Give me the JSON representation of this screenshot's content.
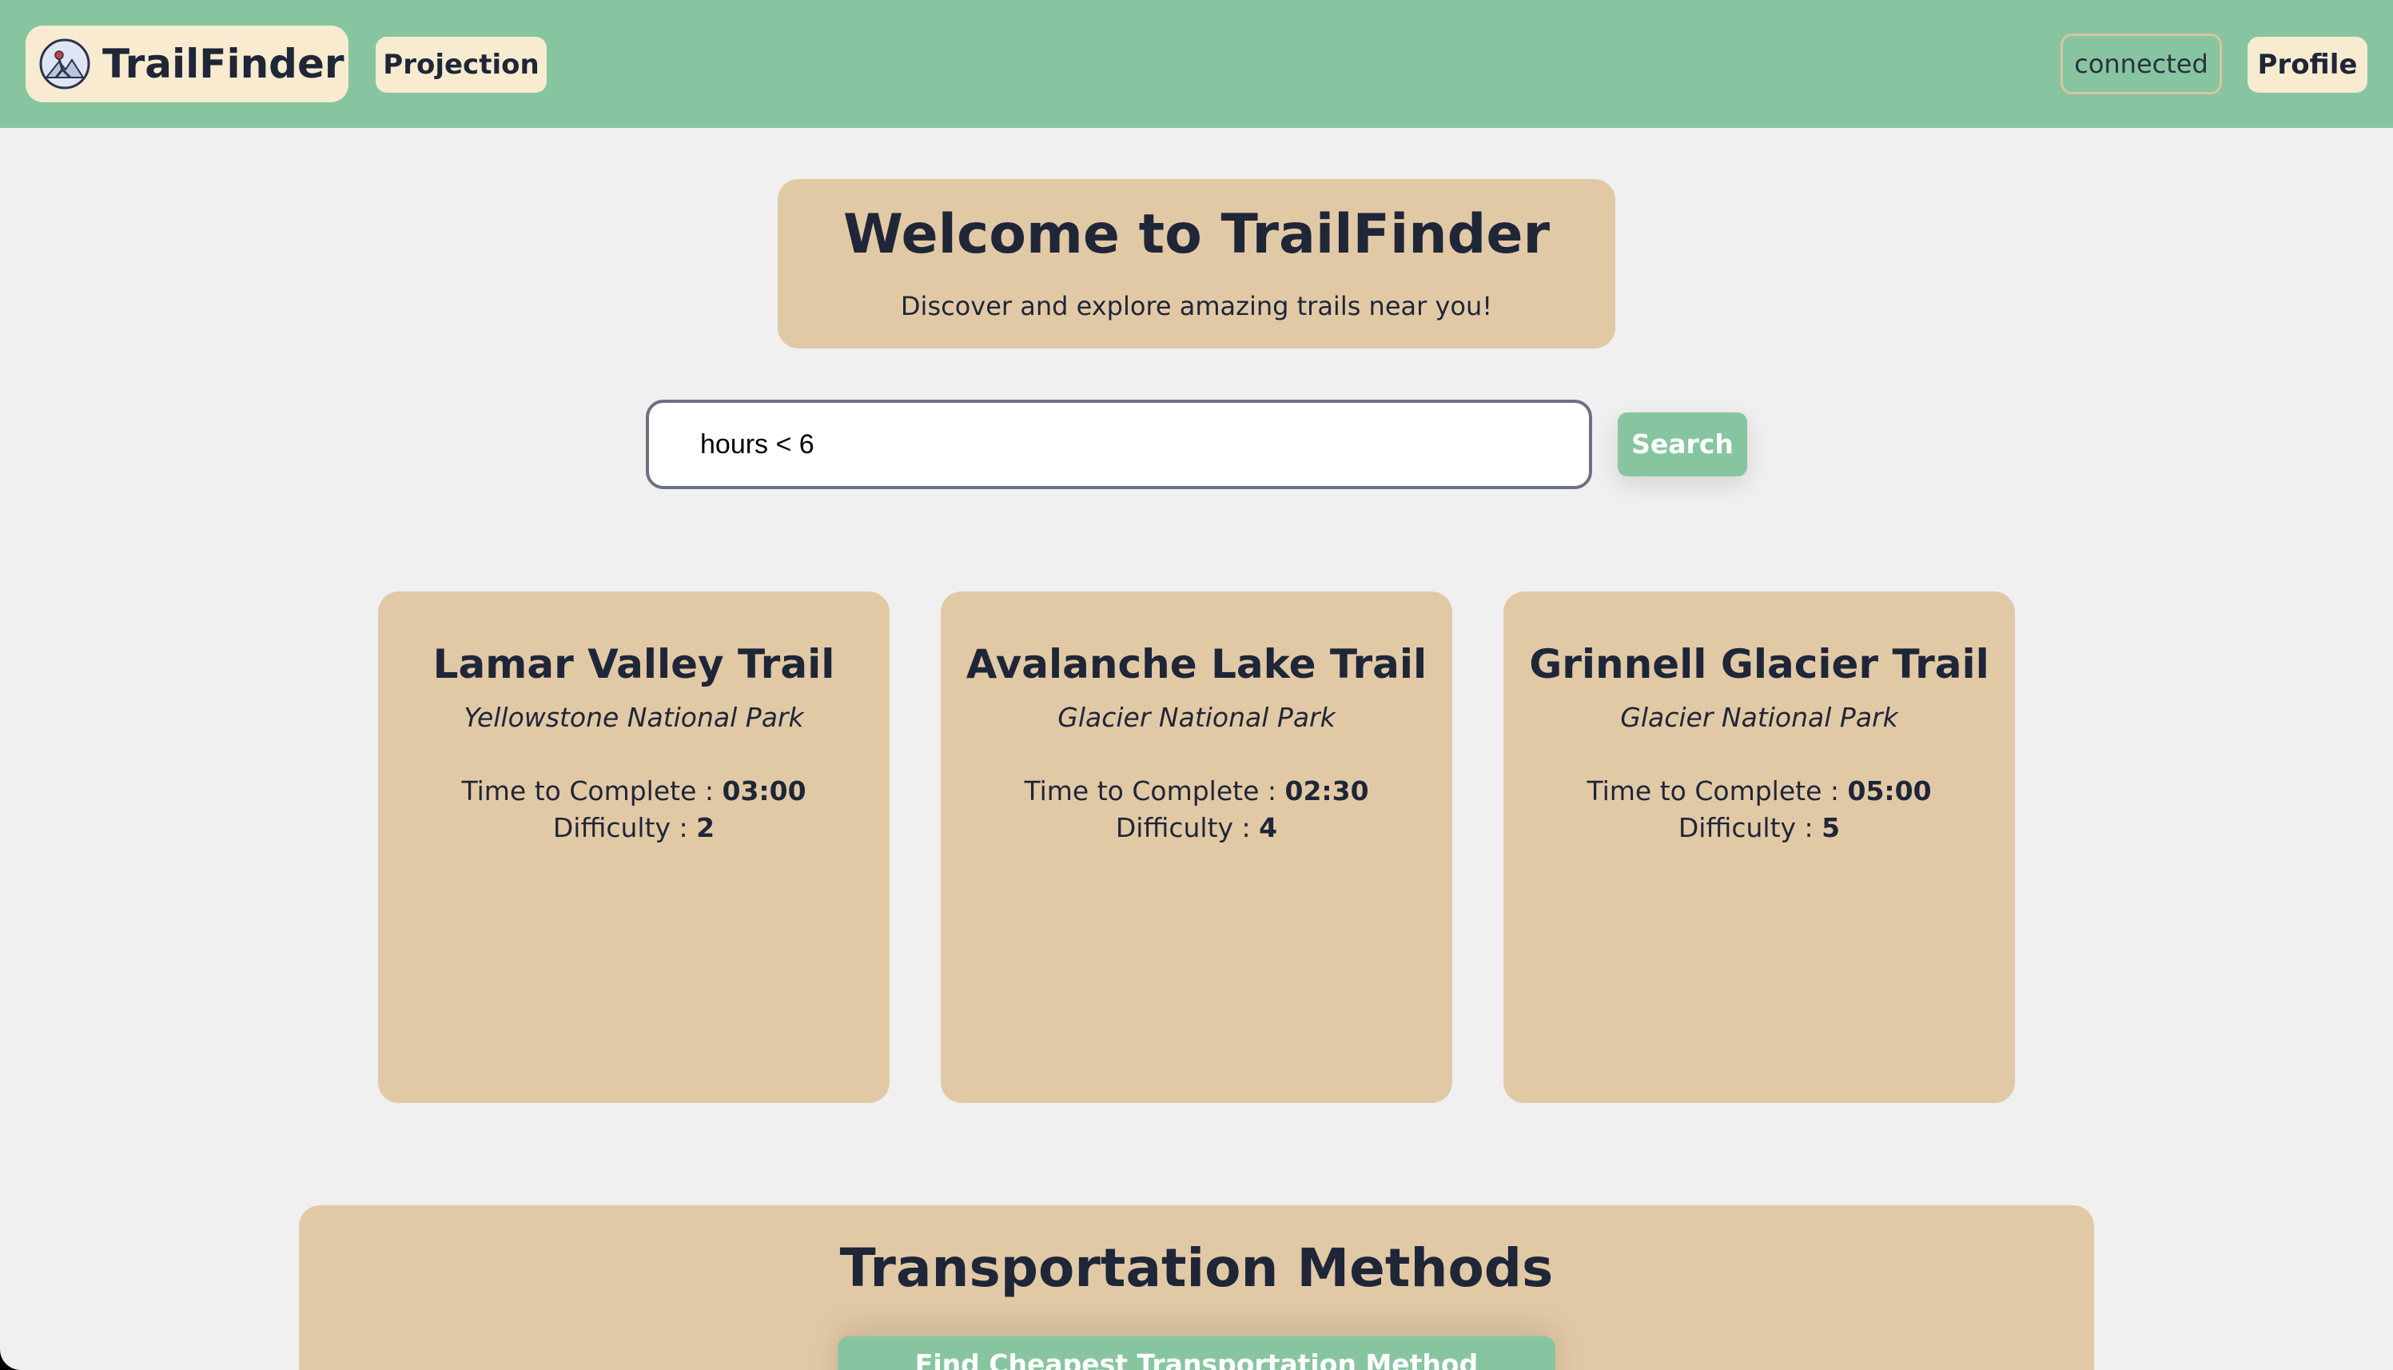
{
  "header": {
    "logo_text": "TrailFinder",
    "projection_label": "Projection",
    "status_text": "connected",
    "profile_label": "Profile",
    "bg_color": "#87c5a0",
    "button_color": "#f8ebcf"
  },
  "welcome": {
    "title": "Welcome to TrailFinder",
    "subtitle": "Discover and explore amazing trails near you!"
  },
  "search": {
    "value": "hours < 6",
    "button_label": "Search"
  },
  "card_labels": {
    "time": "Time to Complete : ",
    "difficulty": "Difficulty : "
  },
  "trails": [
    {
      "name": "Lamar Valley Trail",
      "park": "Yellowstone National Park",
      "time": "03:00",
      "difficulty": "2"
    },
    {
      "name": "Avalanche Lake Trail",
      "park": "Glacier National Park",
      "time": "02:30",
      "difficulty": "4"
    },
    {
      "name": "Grinnell Glacier Trail",
      "park": "Glacier National Park",
      "time": "05:00",
      "difficulty": "5"
    }
  ],
  "transport": {
    "title": "Transportation Methods",
    "button_label": "Find Cheapest Transportation Method"
  },
  "colors": {
    "accent_green": "#87c5a0",
    "card_tan": "#e2c9a6",
    "page_bg": "#f0f0f0",
    "text_dark": "#1e2638"
  }
}
